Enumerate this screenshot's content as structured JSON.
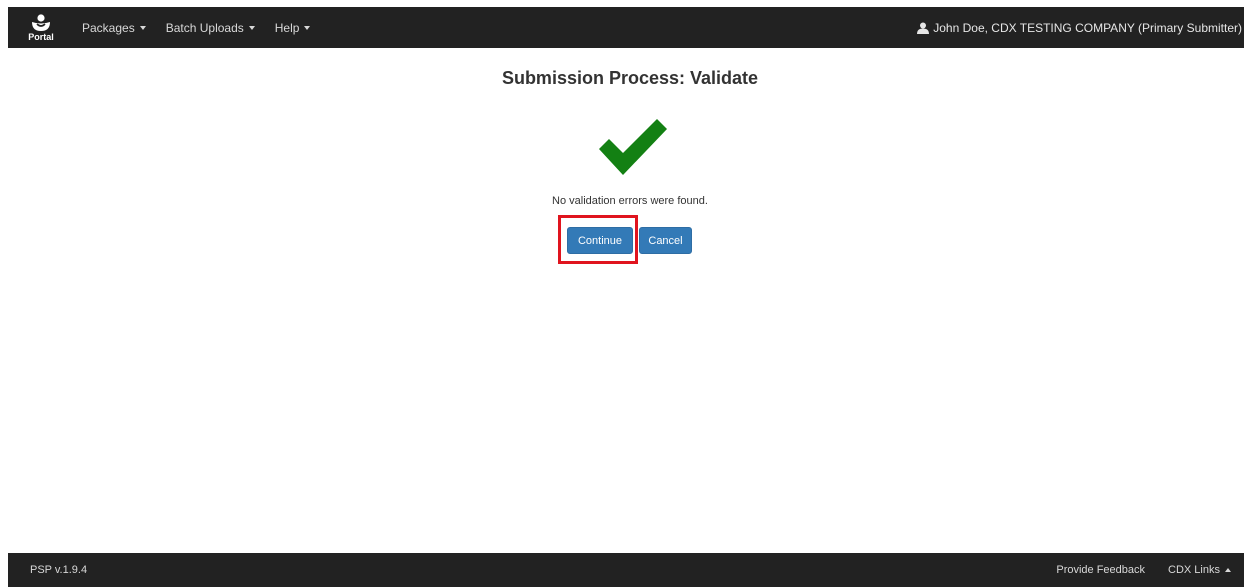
{
  "navbar": {
    "brand_label": "Portal",
    "menu": [
      {
        "label": "Packages"
      },
      {
        "label": "Batch Uploads"
      },
      {
        "label": "Help"
      }
    ],
    "user_label": "John Doe, CDX TESTING COMPANY (Primary Submitter)"
  },
  "main": {
    "title": "Submission Process: Validate",
    "status_icon": "checkmark-icon",
    "status_color": "#138013",
    "message": "No validation errors were found.",
    "continue_label": "Continue",
    "cancel_label": "Cancel",
    "highlight_color": "#e0141e"
  },
  "footer": {
    "version": "PSP  v.1.9.4",
    "feedback_label": "Provide Feedback",
    "cdx_links_label": "CDX Links"
  },
  "colors": {
    "navbar_bg": "#222222",
    "button_bg": "#337ab7"
  }
}
